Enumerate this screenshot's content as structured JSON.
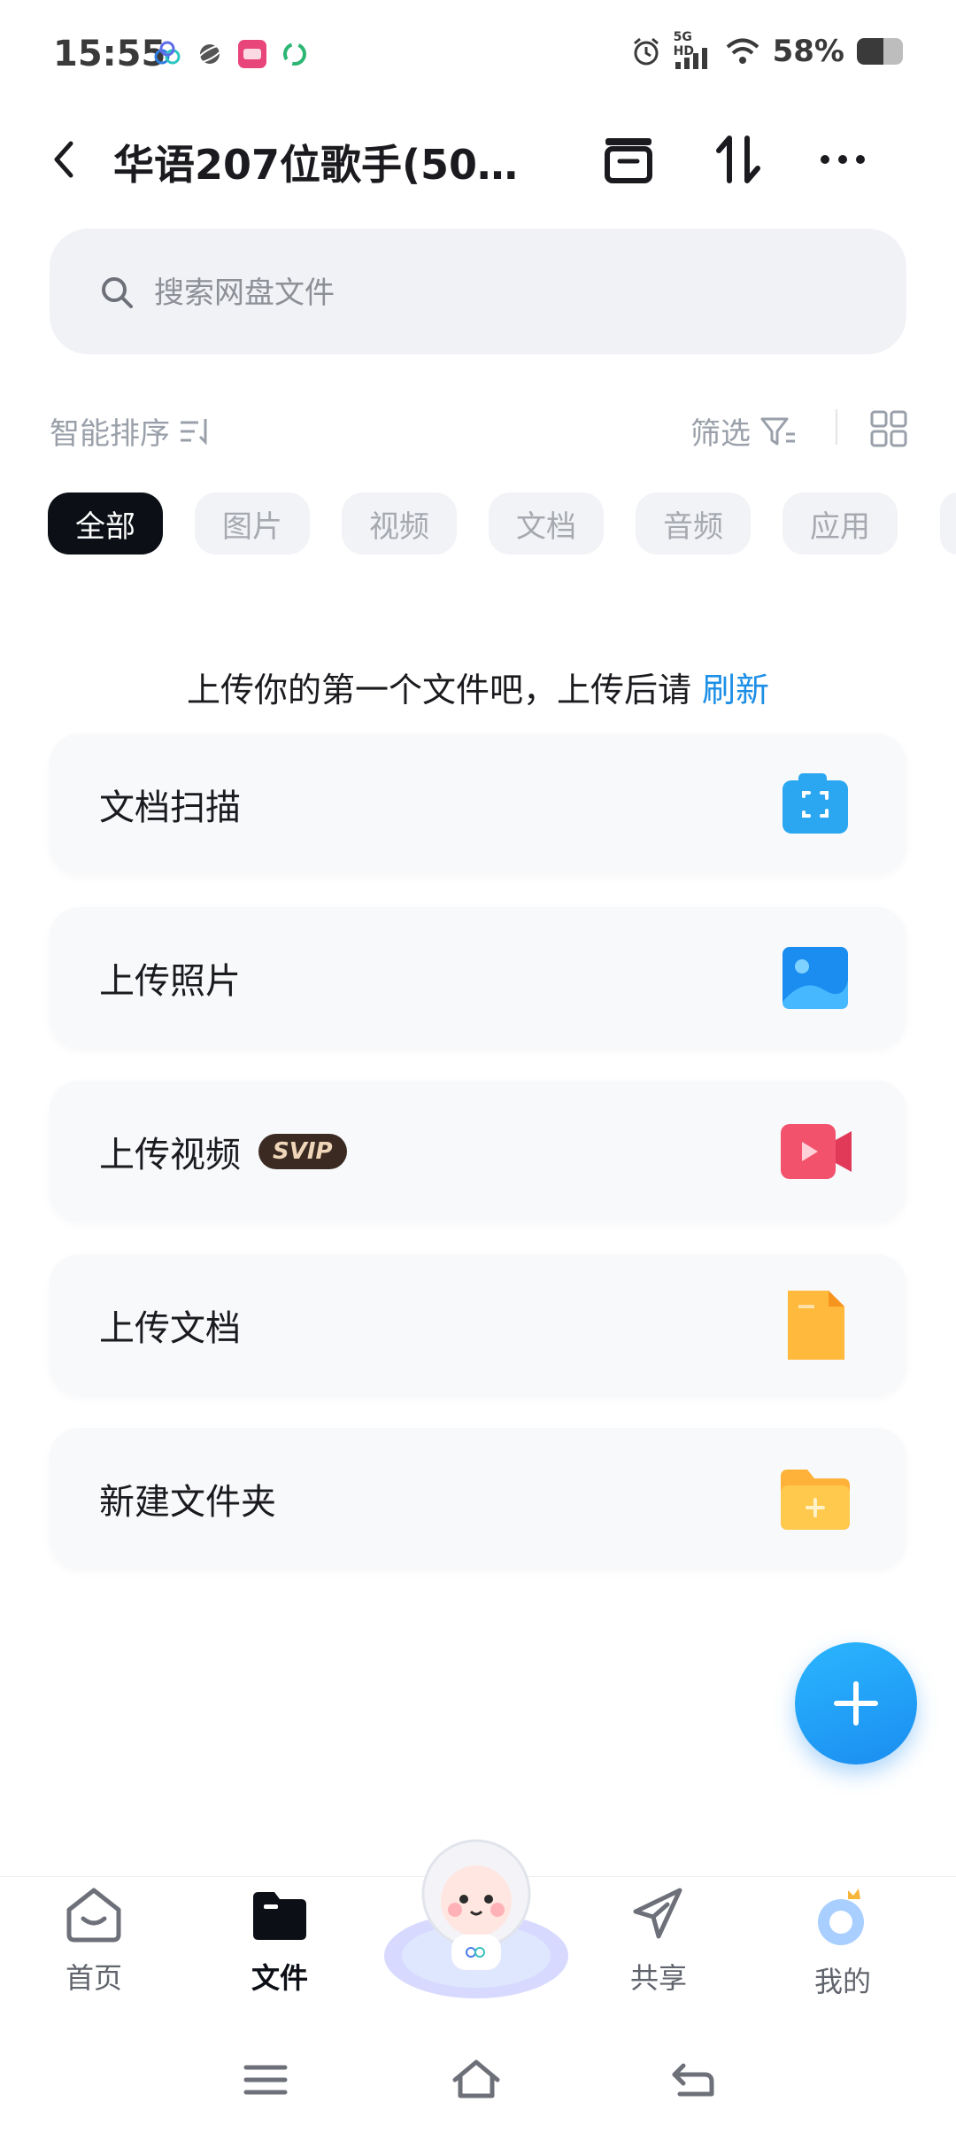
{
  "status_bar": {
    "time": "15:55",
    "network": "5G HD",
    "battery_text": "58%",
    "battery_level": 0.58
  },
  "header": {
    "title": "华语207位歌手(50…"
  },
  "search": {
    "placeholder": "搜索网盘文件"
  },
  "toolbar": {
    "sort_label": "智能排序",
    "filter_label": "筛选"
  },
  "tabs": [
    {
      "label": "全部",
      "active": true
    },
    {
      "label": "图片",
      "active": false
    },
    {
      "label": "视频",
      "active": false
    },
    {
      "label": "文档",
      "active": false
    },
    {
      "label": "音频",
      "active": false
    },
    {
      "label": "应用",
      "active": false
    }
  ],
  "empty_hint": {
    "text": "上传你的第一个文件吧，上传后请",
    "link": "刷新"
  },
  "actions": [
    {
      "label": "文档扫描",
      "icon": "scan-icon"
    },
    {
      "label": "上传照片",
      "icon": "photo-icon"
    },
    {
      "label": "上传视频",
      "icon": "video-icon",
      "badge": "SVIP"
    },
    {
      "label": "上传文档",
      "icon": "document-icon"
    },
    {
      "label": "新建文件夹",
      "icon": "new-folder-icon"
    }
  ],
  "bottom_nav": [
    {
      "label": "首页",
      "icon": "home-icon"
    },
    {
      "label": "文件",
      "icon": "folder-icon",
      "active": true
    },
    {
      "label": "共享",
      "icon": "share-icon"
    },
    {
      "label": "我的",
      "icon": "profile-icon"
    }
  ],
  "colors": {
    "accent": "#1d8fe6",
    "active_tab": "#0c1016",
    "svip_badge": "#3a2a22"
  }
}
